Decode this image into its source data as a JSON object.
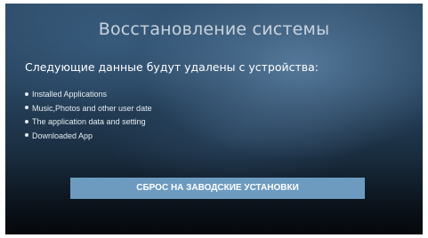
{
  "title": "Восстановление системы",
  "subtitle": "Следующие данные будут удалены с устройства:",
  "items": [
    {
      "label": "Installed Applications"
    },
    {
      "label": "Music,Photos and other user date"
    },
    {
      "label": "The application data and setting"
    },
    {
      "label": "Downloaded App"
    }
  ],
  "reset_button": {
    "label": "СБРОС НА ЗАВОДСКИЕ УСТАНОВКИ"
  },
  "colors": {
    "button": "#6c9bbf",
    "background_top": "#2f4e6a",
    "background_bottom": "#05080c"
  },
  "icons": {
    "bullet": "bullet-dot-icon"
  }
}
